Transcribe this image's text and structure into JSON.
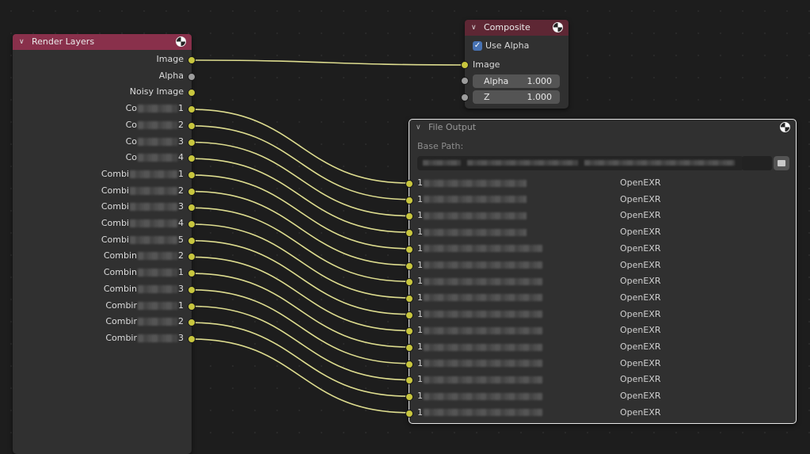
{
  "colors": {
    "link": "#dedd8f",
    "socket": "#c8c63e",
    "socket_gray": "#9d9d9d"
  },
  "render_layers": {
    "title": "Render Layers",
    "outputs": [
      {
        "label": "Image",
        "pre": "Image",
        "post": "",
        "socket": "yellow"
      },
      {
        "label": "Alpha",
        "pre": "Alpha",
        "post": "",
        "socket": "gray"
      },
      {
        "label": "Noisy Image",
        "pre": "Noisy Image",
        "post": "",
        "socket": "yellow"
      },
      {
        "pre": "Co",
        "post": "1",
        "socket": "yellow"
      },
      {
        "pre": "Co",
        "post": "2",
        "socket": "yellow"
      },
      {
        "pre": "Co",
        "post": "3",
        "socket": "yellow"
      },
      {
        "pre": "Co",
        "post": "4",
        "socket": "yellow"
      },
      {
        "pre": "Combi",
        "post": "1",
        "socket": "yellow"
      },
      {
        "pre": "Combi",
        "post": "2",
        "socket": "yellow"
      },
      {
        "pre": "Combi",
        "post": "3",
        "socket": "yellow"
      },
      {
        "pre": "Combi",
        "post": "4",
        "socket": "yellow"
      },
      {
        "pre": "Combi",
        "post": "5",
        "socket": "yellow"
      },
      {
        "pre": "Combin",
        "post": "2",
        "socket": "yellow"
      },
      {
        "pre": "Combin",
        "post": "1",
        "socket": "yellow"
      },
      {
        "pre": "Combin",
        "post": "3",
        "socket": "yellow"
      },
      {
        "pre": "Combir",
        "post": "1",
        "socket": "yellow"
      },
      {
        "pre": "Combir",
        "post": "2",
        "socket": "yellow"
      },
      {
        "pre": "Combir",
        "post": "3",
        "socket": "yellow"
      }
    ]
  },
  "composite": {
    "title": "Composite",
    "use_alpha_label": "Use Alpha",
    "use_alpha_checked": true,
    "image_label": "Image",
    "alpha_label": "Alpha",
    "alpha_value": "1.000",
    "z_label": "Z",
    "z_value": "1.000"
  },
  "file_output": {
    "title": "File Output",
    "base_path_label": "Base Path:",
    "inputs": [
      {
        "pre": "1",
        "format": "OpenEXR"
      },
      {
        "pre": "1",
        "format": "OpenEXR"
      },
      {
        "pre": "1",
        "format": "OpenEXR"
      },
      {
        "pre": "1",
        "format": "OpenEXR"
      },
      {
        "pre": "1",
        "format": "OpenEXR"
      },
      {
        "pre": "1",
        "format": "OpenEXR"
      },
      {
        "pre": "1",
        "format": "OpenEXR"
      },
      {
        "pre": "1",
        "format": "OpenEXR"
      },
      {
        "pre": "1",
        "format": "OpenEXR"
      },
      {
        "pre": "1",
        "format": "OpenEXR"
      },
      {
        "pre": "1",
        "format": "OpenEXR"
      },
      {
        "pre": "1",
        "format": "OpenEXR"
      },
      {
        "pre": "1",
        "format": "OpenEXR"
      },
      {
        "pre": "1",
        "format": "OpenEXR"
      },
      {
        "pre": "1",
        "format": "OpenEXR"
      }
    ]
  }
}
